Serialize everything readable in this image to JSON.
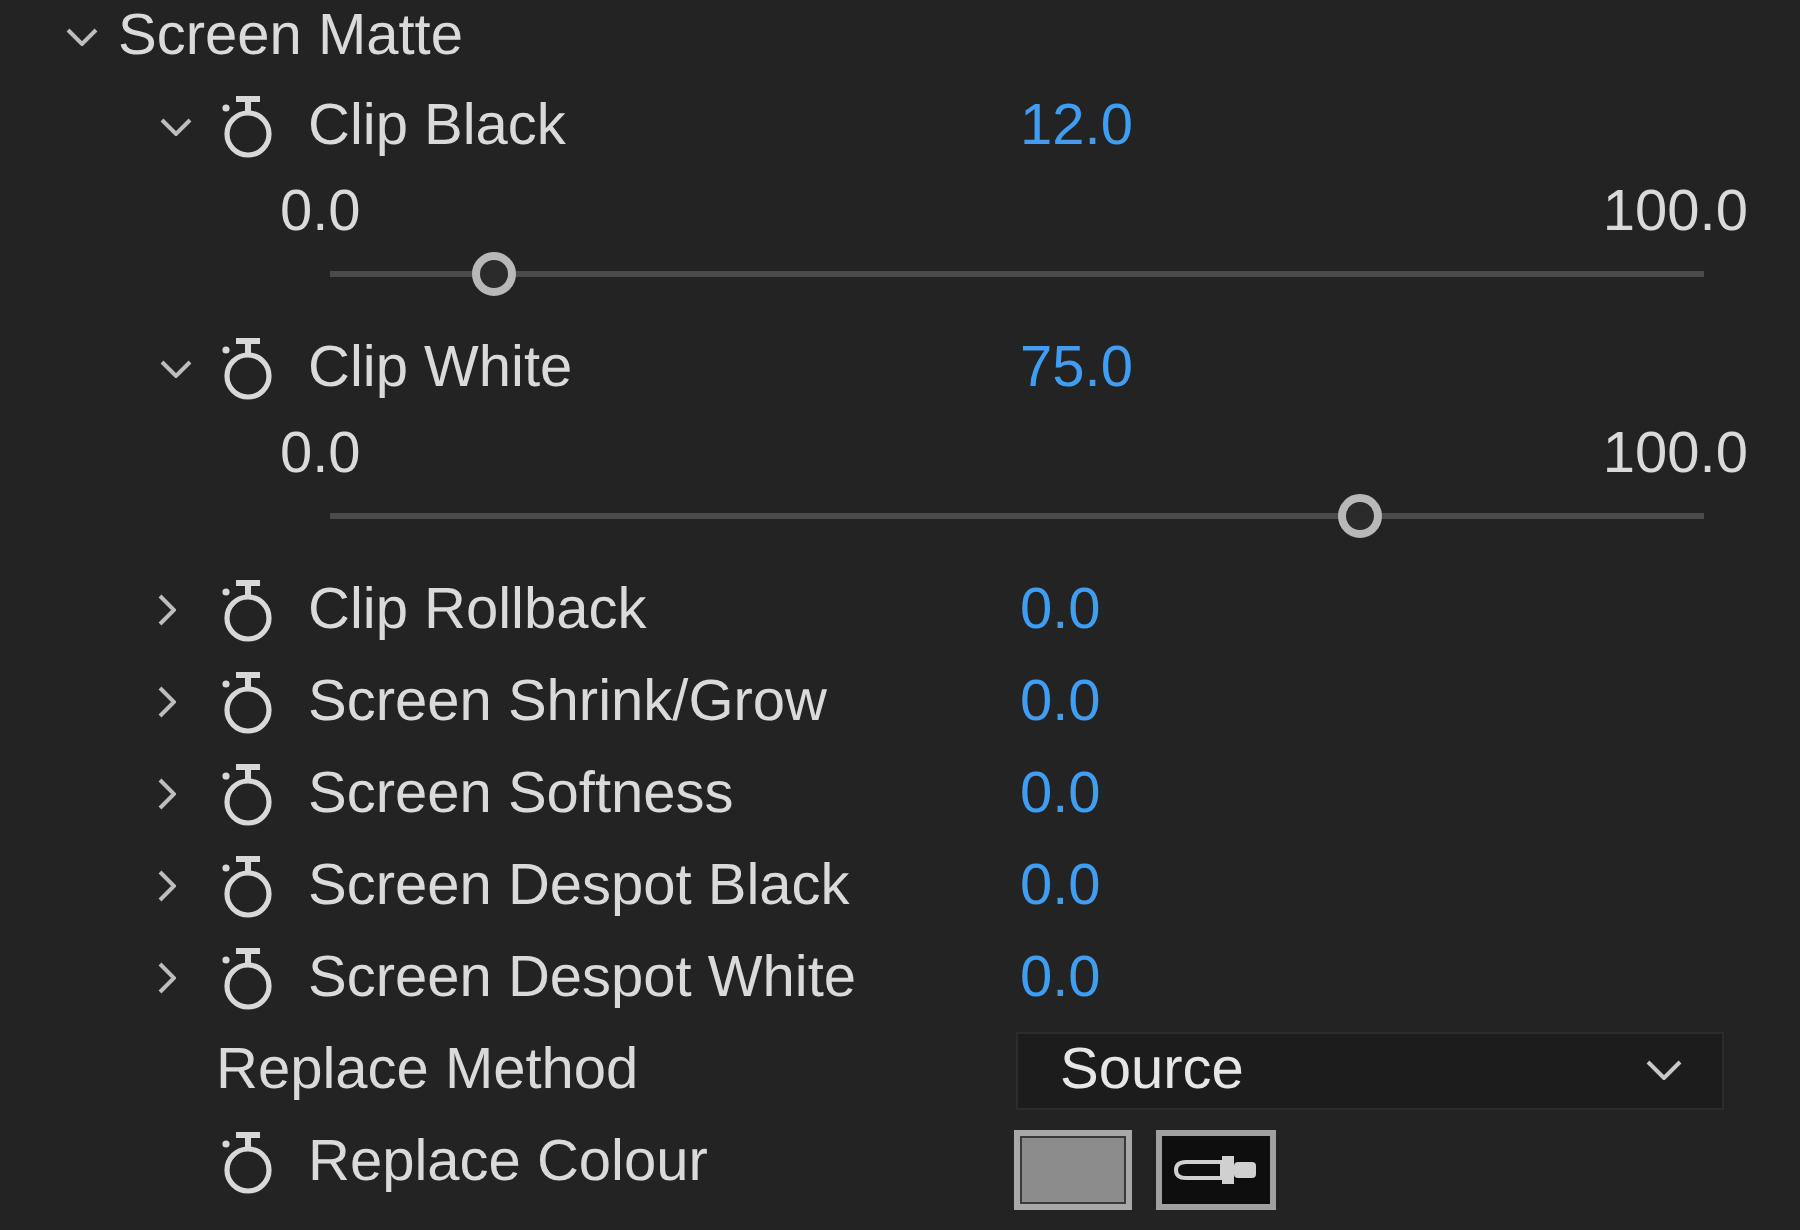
{
  "group": {
    "label": "Screen Matte",
    "expanded": true
  },
  "properties": [
    {
      "kind": "number",
      "label": "Clip Black",
      "expanded": true,
      "stopwatch": true,
      "value": "12.0",
      "range_min": "0.0",
      "range_max": "100.0",
      "level": 0.12
    },
    {
      "kind": "number",
      "label": "Clip White",
      "expanded": true,
      "stopwatch": true,
      "value": "75.0",
      "range_min": "0.0",
      "range_max": "100.0",
      "level": 0.75
    },
    {
      "kind": "number",
      "label": "Clip Rollback",
      "expanded": false,
      "stopwatch": true,
      "value": "0.0"
    },
    {
      "kind": "number",
      "label": "Screen Shrink/Grow",
      "expanded": false,
      "stopwatch": true,
      "value": "0.0"
    },
    {
      "kind": "number",
      "label": "Screen Softness",
      "expanded": false,
      "stopwatch": true,
      "value": "0.0"
    },
    {
      "kind": "number",
      "label": "Screen Despot Black",
      "expanded": false,
      "stopwatch": true,
      "value": "0.0"
    },
    {
      "kind": "number",
      "label": "Screen Despot White",
      "expanded": false,
      "stopwatch": true,
      "value": "0.0"
    },
    {
      "kind": "dropdown",
      "label": "Replace Method",
      "stopwatch": false,
      "value": "Source"
    },
    {
      "kind": "color",
      "label": "Replace Colour",
      "stopwatch": true,
      "color": "#8c8c8c"
    }
  ]
}
